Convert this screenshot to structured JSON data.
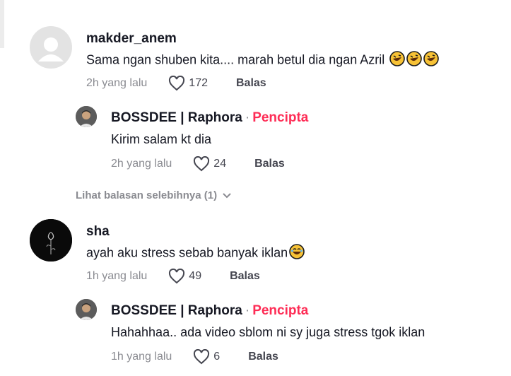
{
  "comments": [
    {
      "username": "makder_anem",
      "text": "Sama ngan shuben kita.... marah betul dia ngan Azril",
      "emoji": [
        "rolling-laughing-emoji",
        "rolling-laughing-emoji",
        "rolling-laughing-emoji"
      ],
      "time": "2h yang lalu",
      "likes": "172",
      "reply_label": "Balas",
      "avatar_icon": "default-user-avatar",
      "reply": {
        "username": "BOSSDEE | Raphora",
        "separator": "·",
        "badge": "Pencipta",
        "text": "Kirim salam kt dia",
        "time": "2h yang lalu",
        "likes": "24",
        "reply_label": "Balas"
      },
      "view_more": "Lihat balasan selebihnya (1)"
    },
    {
      "username": "sha",
      "text": "ayah aku stress sebab banyak iklan",
      "emoji": [
        "laughing-emoji"
      ],
      "time": "1h yang lalu",
      "likes": "49",
      "reply_label": "Balas",
      "avatar_icon": "rose-avatar",
      "reply": {
        "username": "BOSSDEE | Raphora",
        "separator": "·",
        "badge": "Pencipta",
        "text": "Hahahhaa.. ada video sblom ni sy juga stress tgok iklan",
        "time": "1h yang lalu",
        "likes": "6",
        "reply_label": "Balas"
      }
    }
  ],
  "colors": {
    "creator_badge": "#fe2c55",
    "meta": "#8a8b91",
    "text": "#161823"
  }
}
